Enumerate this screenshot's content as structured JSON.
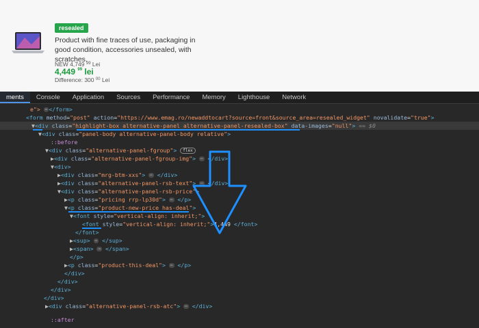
{
  "product": {
    "badge": "resealed",
    "description": "Product with fine traces of use, packaging in good condition, accessories unsealed, with scratches.",
    "old_price": {
      "prefix": "NEW ",
      "amount": "4,749",
      "decimals": "99",
      "currency": "Lei"
    },
    "new_price": {
      "amount": "4,449",
      "decimals": "99",
      "currency": "lei"
    },
    "difference": {
      "prefix": "Difference: ",
      "amount": "300",
      "decimals": "00",
      "currency": "Lei"
    }
  },
  "devtools": {
    "tabs": [
      "ments",
      "Console",
      "Application",
      "Sources",
      "Performance",
      "Memory",
      "Lighthouse",
      "Network"
    ],
    "active_tab": "ments"
  },
  "tree": {
    "l1_tail": "e\">",
    "l1_close": "</form>",
    "l2_attr1": "method",
    "l2_val1": "\"post\"",
    "l2_attr2": "action",
    "l2_val2": "\"https://www.emag.ro/newaddtocart?source=front&source_area=resealed_widget\"",
    "l2_attr3": "novalidate",
    "l2_val3": "\"true\"",
    "l3_class": "\"highlight-box alternative-panel alternative-panel-resealed-box\"",
    "l3_attr2": "data-images",
    "l3_val2": "\"null\"",
    "l3_eq": "== $0",
    "l4_class": "\"panel-body alternative-panel-body relative\"",
    "l5_before": "::before",
    "l6_class": "\"alternative-panel-fgroup\"",
    "l6_badge": "flex",
    "l7_class": "\"alternative-panel-fgroup-img\"",
    "l9_class": "\"mrg-btm-xxs\"",
    "l10_class": "\"alternative-panel-rsb-text\"",
    "l11_class": "\"alternative-panel-rsb-price\"",
    "l12_class": "\"pricing rrp-lp30d\"",
    "l13_class": "\"product-new-price has-deal\"",
    "l14_attr": "style",
    "l14_val": "\"vertical-align: inherit;\"",
    "l15_attr": "style",
    "l15_val": "\"vertical-align: inherit;\"",
    "l15_text": "4,449",
    "l20_class": "\"product-this-deal\"",
    "l24_class": "\"alternative-panel-rsb-atc\"",
    "l25_after": "::after",
    "ellipsis": "⋯"
  },
  "colors": {
    "badge_green": "#27a54a",
    "price_green": "#1c9a3c",
    "highlight_blue": "#1e90ff",
    "devtools_bg": "#282828"
  },
  "icons": [
    "laptop-icon",
    "expand-triangle-icon",
    "collapse-triangle-icon",
    "down-arrow-annotation-icon"
  ]
}
